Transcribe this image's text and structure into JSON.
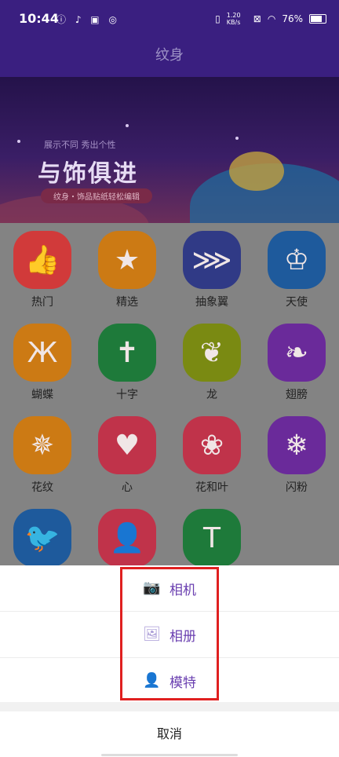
{
  "status_bar": {
    "time": "10:44",
    "left_icons": "ⓘ ♪ ▣ ◎",
    "network_speed": "1.20 KB/s",
    "battery": "76%"
  },
  "header": {
    "title": "纹身"
  },
  "banner": {
    "subtitle": "展示不同 秀出个性",
    "headline": "与饰俱进",
    "tagline": "纹身・饰品贴纸轻松编辑"
  },
  "categories": [
    {
      "label": "热门",
      "icon": "thumbs-up-icon",
      "glyph": "👍",
      "color": "#d13a3a"
    },
    {
      "label": "精选",
      "icon": "star-face-icon",
      "glyph": "★",
      "color": "#cc7a14"
    },
    {
      "label": "抽象翼",
      "icon": "abstract-wing-icon",
      "glyph": "⋙",
      "color": "#303a86"
    },
    {
      "label": "天使",
      "icon": "angel-icon",
      "glyph": "♔",
      "color": "#1e5a9c"
    },
    {
      "label": "蝴蝶",
      "icon": "butterfly-icon",
      "glyph": "Ж",
      "color": "#cc7a14"
    },
    {
      "label": "十字",
      "icon": "cross-icon",
      "glyph": "✝",
      "color": "#1e7a3a"
    },
    {
      "label": "龙",
      "icon": "dragon-icon",
      "glyph": "❦",
      "color": "#7a8a12"
    },
    {
      "label": "翅膀",
      "icon": "wing-icon",
      "glyph": "❧",
      "color": "#6a2a9a"
    },
    {
      "label": "花纹",
      "icon": "pattern-icon",
      "glyph": "✵",
      "color": "#cc7a14"
    },
    {
      "label": "心",
      "icon": "heart-icon",
      "glyph": "♥",
      "color": "#c0334a"
    },
    {
      "label": "花和叶",
      "icon": "flower-icon",
      "glyph": "❀",
      "color": "#c0334a"
    },
    {
      "label": "闪粉",
      "icon": "snowflake-icon",
      "glyph": "❄",
      "color": "#6a2a9a"
    },
    {
      "label": "",
      "icon": "bird-icon",
      "glyph": "🐦",
      "color": "#1e5a9c"
    },
    {
      "label": "",
      "icon": "person-icon",
      "glyph": "👤",
      "color": "#c0334a"
    },
    {
      "label": "",
      "icon": "text-icon",
      "glyph": "T",
      "color": "#1e7a3a"
    }
  ],
  "sheet": {
    "options": [
      {
        "label": "相机",
        "icon": "camera-icon",
        "glyph": "📷"
      },
      {
        "label": "相册",
        "icon": "album-icon",
        "glyph": "🖼"
      },
      {
        "label": "模特",
        "icon": "model-icon",
        "glyph": "👤"
      }
    ],
    "cancel": "取消"
  }
}
